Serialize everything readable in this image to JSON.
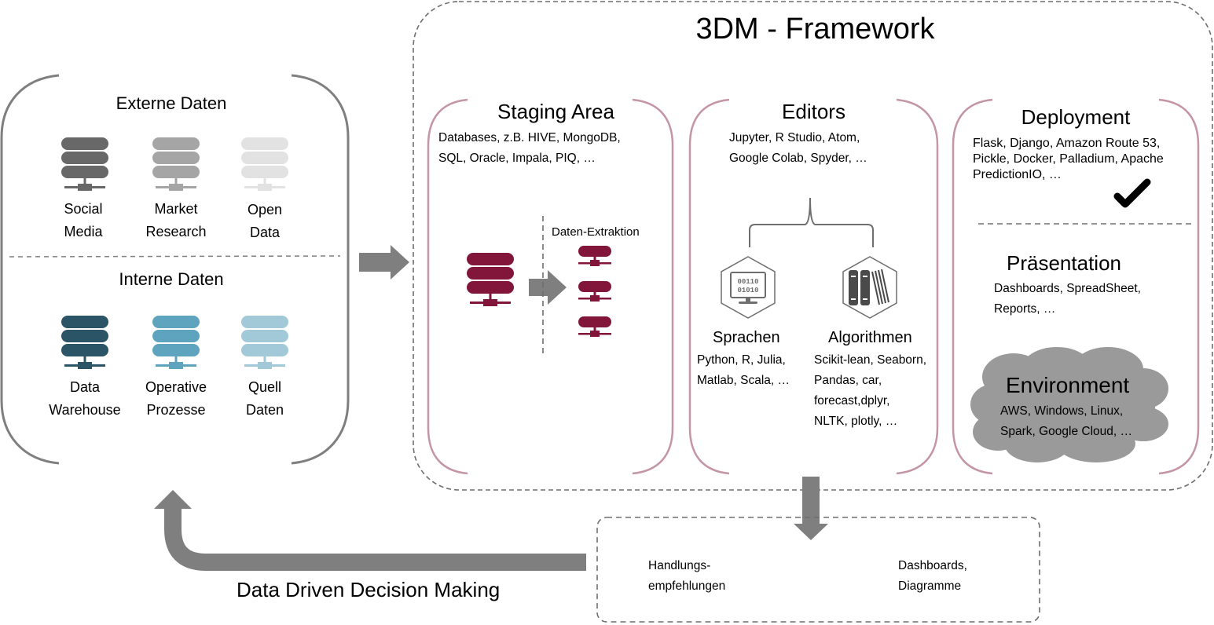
{
  "framework": {
    "title": "3DM - Framework"
  },
  "sources": {
    "external": {
      "title": "Externe Daten",
      "items": [
        {
          "label_line1": "Social",
          "label_line2": "Media",
          "icon": "database-server-icon",
          "color": "#686868"
        },
        {
          "label_line1": "Market",
          "label_line2": "Research",
          "icon": "database-server-icon",
          "color": "#a5a5a5"
        },
        {
          "label_line1": "Open",
          "label_line2": "Data",
          "icon": "database-server-icon",
          "color": "#e2e2e2"
        }
      ]
    },
    "internal": {
      "title": "Interne Daten",
      "items": [
        {
          "label_line1": "Data",
          "label_line2": "Warehouse",
          "icon": "database-server-icon",
          "color": "#2b5466"
        },
        {
          "label_line1": "Operative",
          "label_line2": "Prozesse",
          "icon": "database-server-icon",
          "color": "#5fa4bf"
        },
        {
          "label_line1": "Quell",
          "label_line2": "Daten",
          "icon": "database-server-icon",
          "color": "#a2c9d8"
        }
      ]
    }
  },
  "staging": {
    "title": "Staging Area",
    "desc_line1": "Databases, z.B. HIVE, MongoDB,",
    "desc_line2": "SQL, Oracle, Impala, PIQ, …",
    "extraction_label": "Daten-Extraktion",
    "icon_color": "#82163a"
  },
  "editors": {
    "title": "Editors",
    "desc_line1": "Jupyter, R Studio, Atom,",
    "desc_line2": "Google Colab, Spyder, …",
    "languages": {
      "title": "Sprachen",
      "lines": [
        "Python, R, Julia,",
        "Matlab, Scala, …"
      ],
      "icon": "binary-monitor-icon",
      "binary_line1": "00110",
      "binary_line2": "01010"
    },
    "algorithms": {
      "title": "Algorithmen",
      "lines": [
        "Scikit-lean, Seaborn,",
        "Pandas, car,",
        "forecast,dplyr,",
        "NLTK, plotly, …"
      ],
      "icon": "books-icon"
    }
  },
  "deployment": {
    "title": "Deployment",
    "lines": [
      "Flask, Django, Amazon Route 53,",
      "Pickle, Docker, Palladium, Apache",
      "PredictionIO, …"
    ],
    "icon": "checkmark-icon"
  },
  "presentation": {
    "title": "Präsentation",
    "lines": [
      "Dashboards, SpreadSheet,",
      "Reports, …"
    ]
  },
  "environment": {
    "title": "Environment",
    "lines": [
      "AWS, Windows, Linux,",
      "Spark, Google Cloud, …"
    ],
    "cloud_color": "#9a9a9a"
  },
  "output": {
    "left_line1": "Handlungs-",
    "left_line2": "empfehlungen",
    "right_line1": "Dashboards,",
    "right_line2": "Diagramme"
  },
  "feedback": {
    "label": "Data Driven Decision Making"
  },
  "colors": {
    "bracket_gray": "#7f7f7f",
    "bracket_rose": "#c495a3",
    "arrow_gray": "#7f7f7f",
    "dash_gray": "#6e6e6e"
  }
}
